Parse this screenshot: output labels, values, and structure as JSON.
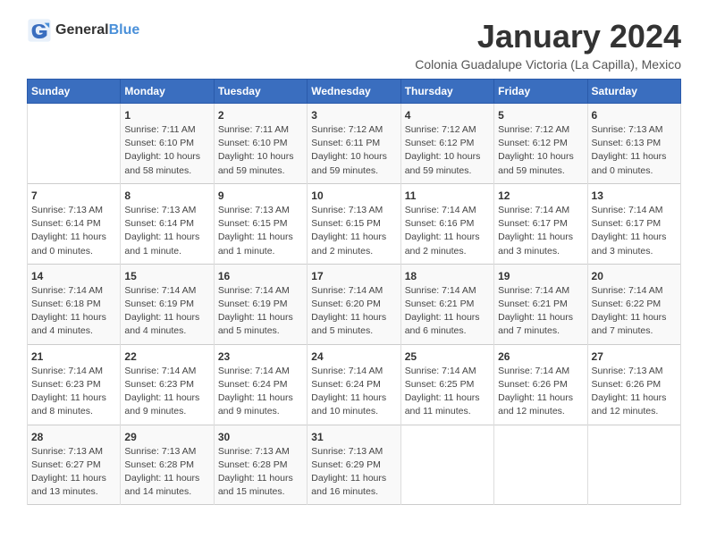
{
  "logo": {
    "general": "General",
    "blue": "Blue"
  },
  "title": "January 2024",
  "subtitle": "Colonia Guadalupe Victoria (La Capilla), Mexico",
  "days_of_week": [
    "Sunday",
    "Monday",
    "Tuesday",
    "Wednesday",
    "Thursday",
    "Friday",
    "Saturday"
  ],
  "weeks": [
    [
      {
        "day": "",
        "sunrise": "",
        "sunset": "",
        "daylight": ""
      },
      {
        "day": "1",
        "sunrise": "Sunrise: 7:11 AM",
        "sunset": "Sunset: 6:10 PM",
        "daylight": "Daylight: 10 hours and 58 minutes."
      },
      {
        "day": "2",
        "sunrise": "Sunrise: 7:11 AM",
        "sunset": "Sunset: 6:10 PM",
        "daylight": "Daylight: 10 hours and 59 minutes."
      },
      {
        "day": "3",
        "sunrise": "Sunrise: 7:12 AM",
        "sunset": "Sunset: 6:11 PM",
        "daylight": "Daylight: 10 hours and 59 minutes."
      },
      {
        "day": "4",
        "sunrise": "Sunrise: 7:12 AM",
        "sunset": "Sunset: 6:12 PM",
        "daylight": "Daylight: 10 hours and 59 minutes."
      },
      {
        "day": "5",
        "sunrise": "Sunrise: 7:12 AM",
        "sunset": "Sunset: 6:12 PM",
        "daylight": "Daylight: 10 hours and 59 minutes."
      },
      {
        "day": "6",
        "sunrise": "Sunrise: 7:13 AM",
        "sunset": "Sunset: 6:13 PM",
        "daylight": "Daylight: 11 hours and 0 minutes."
      }
    ],
    [
      {
        "day": "7",
        "sunrise": "Sunrise: 7:13 AM",
        "sunset": "Sunset: 6:14 PM",
        "daylight": "Daylight: 11 hours and 0 minutes."
      },
      {
        "day": "8",
        "sunrise": "Sunrise: 7:13 AM",
        "sunset": "Sunset: 6:14 PM",
        "daylight": "Daylight: 11 hours and 1 minute."
      },
      {
        "day": "9",
        "sunrise": "Sunrise: 7:13 AM",
        "sunset": "Sunset: 6:15 PM",
        "daylight": "Daylight: 11 hours and 1 minute."
      },
      {
        "day": "10",
        "sunrise": "Sunrise: 7:13 AM",
        "sunset": "Sunset: 6:15 PM",
        "daylight": "Daylight: 11 hours and 2 minutes."
      },
      {
        "day": "11",
        "sunrise": "Sunrise: 7:14 AM",
        "sunset": "Sunset: 6:16 PM",
        "daylight": "Daylight: 11 hours and 2 minutes."
      },
      {
        "day": "12",
        "sunrise": "Sunrise: 7:14 AM",
        "sunset": "Sunset: 6:17 PM",
        "daylight": "Daylight: 11 hours and 3 minutes."
      },
      {
        "day": "13",
        "sunrise": "Sunrise: 7:14 AM",
        "sunset": "Sunset: 6:17 PM",
        "daylight": "Daylight: 11 hours and 3 minutes."
      }
    ],
    [
      {
        "day": "14",
        "sunrise": "Sunrise: 7:14 AM",
        "sunset": "Sunset: 6:18 PM",
        "daylight": "Daylight: 11 hours and 4 minutes."
      },
      {
        "day": "15",
        "sunrise": "Sunrise: 7:14 AM",
        "sunset": "Sunset: 6:19 PM",
        "daylight": "Daylight: 11 hours and 4 minutes."
      },
      {
        "day": "16",
        "sunrise": "Sunrise: 7:14 AM",
        "sunset": "Sunset: 6:19 PM",
        "daylight": "Daylight: 11 hours and 5 minutes."
      },
      {
        "day": "17",
        "sunrise": "Sunrise: 7:14 AM",
        "sunset": "Sunset: 6:20 PM",
        "daylight": "Daylight: 11 hours and 5 minutes."
      },
      {
        "day": "18",
        "sunrise": "Sunrise: 7:14 AM",
        "sunset": "Sunset: 6:21 PM",
        "daylight": "Daylight: 11 hours and 6 minutes."
      },
      {
        "day": "19",
        "sunrise": "Sunrise: 7:14 AM",
        "sunset": "Sunset: 6:21 PM",
        "daylight": "Daylight: 11 hours and 7 minutes."
      },
      {
        "day": "20",
        "sunrise": "Sunrise: 7:14 AM",
        "sunset": "Sunset: 6:22 PM",
        "daylight": "Daylight: 11 hours and 7 minutes."
      }
    ],
    [
      {
        "day": "21",
        "sunrise": "Sunrise: 7:14 AM",
        "sunset": "Sunset: 6:23 PM",
        "daylight": "Daylight: 11 hours and 8 minutes."
      },
      {
        "day": "22",
        "sunrise": "Sunrise: 7:14 AM",
        "sunset": "Sunset: 6:23 PM",
        "daylight": "Daylight: 11 hours and 9 minutes."
      },
      {
        "day": "23",
        "sunrise": "Sunrise: 7:14 AM",
        "sunset": "Sunset: 6:24 PM",
        "daylight": "Daylight: 11 hours and 9 minutes."
      },
      {
        "day": "24",
        "sunrise": "Sunrise: 7:14 AM",
        "sunset": "Sunset: 6:24 PM",
        "daylight": "Daylight: 11 hours and 10 minutes."
      },
      {
        "day": "25",
        "sunrise": "Sunrise: 7:14 AM",
        "sunset": "Sunset: 6:25 PM",
        "daylight": "Daylight: 11 hours and 11 minutes."
      },
      {
        "day": "26",
        "sunrise": "Sunrise: 7:14 AM",
        "sunset": "Sunset: 6:26 PM",
        "daylight": "Daylight: 11 hours and 12 minutes."
      },
      {
        "day": "27",
        "sunrise": "Sunrise: 7:13 AM",
        "sunset": "Sunset: 6:26 PM",
        "daylight": "Daylight: 11 hours and 12 minutes."
      }
    ],
    [
      {
        "day": "28",
        "sunrise": "Sunrise: 7:13 AM",
        "sunset": "Sunset: 6:27 PM",
        "daylight": "Daylight: 11 hours and 13 minutes."
      },
      {
        "day": "29",
        "sunrise": "Sunrise: 7:13 AM",
        "sunset": "Sunset: 6:28 PM",
        "daylight": "Daylight: 11 hours and 14 minutes."
      },
      {
        "day": "30",
        "sunrise": "Sunrise: 7:13 AM",
        "sunset": "Sunset: 6:28 PM",
        "daylight": "Daylight: 11 hours and 15 minutes."
      },
      {
        "day": "31",
        "sunrise": "Sunrise: 7:13 AM",
        "sunset": "Sunset: 6:29 PM",
        "daylight": "Daylight: 11 hours and 16 minutes."
      },
      {
        "day": "",
        "sunrise": "",
        "sunset": "",
        "daylight": ""
      },
      {
        "day": "",
        "sunrise": "",
        "sunset": "",
        "daylight": ""
      },
      {
        "day": "",
        "sunrise": "",
        "sunset": "",
        "daylight": ""
      }
    ]
  ]
}
